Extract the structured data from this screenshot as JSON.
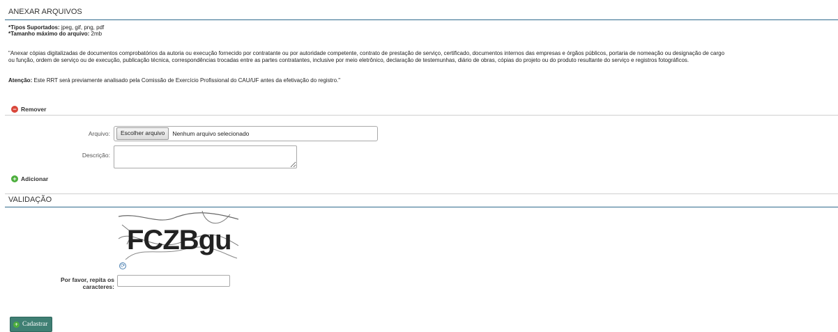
{
  "anexar": {
    "title": "ANEXAR ARQUIVOS",
    "tipos_label": "*Tipos Suportados:",
    "tipos_value": " jpeg, gif, png, pdf",
    "tamanho_label": "*Tamanho máximo do arquivo:",
    "tamanho_value": " 2mb",
    "description_line1": "\"Anexar cópias digitalizadas de documentos comprobatórios da autoria ou execução fornecido por contratante ou por autoridade competente, contrato de prestação de serviço, certificado, documentos internos das empresas e órgãos públicos, portaria de nomeação ou designação de cargo",
    "description_line2": "ou função, ordem de serviço ou de execução, publicação técnica, correspondências trocadas entre as partes contratantes, inclusive por meio eletrônico, declaração de testemunhas, diário de obras, cópias do projeto ou do produto resultante do serviço e registros fotográficos.",
    "atencao_label": "Atenção:",
    "atencao_text": " Este RRT será previamente analisado pela Comissão de Exercício Profissional do CAU/UF antes da efetivação do registro.\"",
    "remover_label": "Remover",
    "arquivo_label": "Arquivo:",
    "file_button_label": "Escolher arquivo",
    "file_status": "Nenhum arquivo selecionado",
    "descricao_label": "Descrição:",
    "descricao_value": "",
    "adicionar_label": "Adicionar"
  },
  "validacao": {
    "title": "VALIDAÇÃO",
    "captcha_text": "FCZBgu",
    "prompt_line1": "Por favor, repita os",
    "prompt_line2": "caracteres:",
    "captcha_input_value": ""
  },
  "submit_label": "Cadastrar",
  "icons": {
    "remover": "minus-circle-icon",
    "adicionar": "plus-circle-icon",
    "refresh": "refresh-icon",
    "submit": "plus-circle-icon"
  },
  "colors": {
    "header_rule": "#2f6a8c",
    "remove_red": "#d9463a",
    "add_green": "#4cae3c",
    "submit_bg": "#3f7f73"
  }
}
